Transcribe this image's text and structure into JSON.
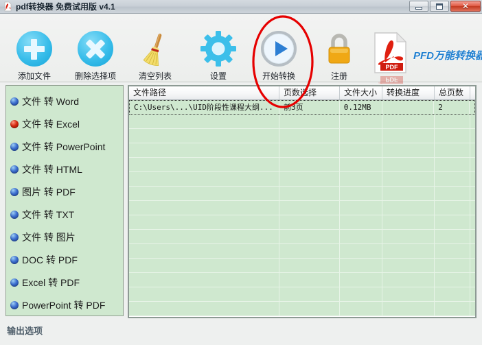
{
  "window": {
    "title": "pdf转换器 免费试用版 v4.1",
    "icon": "pdf-app-icon",
    "controls": [
      {
        "name": "minimize-button",
        "glyph": "minimize-icon"
      },
      {
        "name": "maximize-button",
        "glyph": "maximize-icon"
      },
      {
        "name": "close-button",
        "glyph": "close-icon",
        "label": "✕"
      }
    ]
  },
  "toolbar": {
    "buttons": [
      {
        "id": "add-file",
        "label": "添加文件",
        "icon": "plus-circle-icon"
      },
      {
        "id": "delete-selected",
        "label": "删除选择项",
        "icon": "cross-circle-icon"
      },
      {
        "id": "clear-list",
        "label": "清空列表",
        "icon": "broom-icon"
      },
      {
        "id": "settings",
        "label": "设置",
        "icon": "gear-icon"
      },
      {
        "id": "start-convert",
        "label": "开始转换",
        "icon": "play-circle-icon"
      },
      {
        "id": "register",
        "label": "注册",
        "icon": "lock-icon"
      }
    ],
    "logo": {
      "text": "PFD万能转换器",
      "icon": "pdf-document-icon",
      "icon_label": "PDF",
      "text_color": "#1f7fd0"
    },
    "annotation": {
      "name": "red-ellipse-highlight",
      "target": "start-convert",
      "color": "#e60000"
    }
  },
  "sidebar": {
    "selected_index": 1,
    "items": [
      {
        "label": "文件 转 Word"
      },
      {
        "label": "文件 转 Excel"
      },
      {
        "label": "文件 转 PowerPoint"
      },
      {
        "label": "文件 转 HTML"
      },
      {
        "label": "图片 转 PDF"
      },
      {
        "label": "文件 转 TXT"
      },
      {
        "label": "文件 转 图片"
      },
      {
        "label": "DOC 转 PDF"
      },
      {
        "label": "Excel 转 PDF"
      },
      {
        "label": "PowerPoint 转 PDF"
      }
    ],
    "radio_unselected_color": "#3d6fd0",
    "radio_selected_color": "#d62a10"
  },
  "output_options_label": "输出选项",
  "file_table": {
    "columns": [
      "文件路径",
      "页数选择",
      "文件大小",
      "转换进度",
      "总页数",
      ""
    ],
    "rows": [
      {
        "path": "C:\\Users\\...\\UID阶段性课程大纲...",
        "pages": "前3页",
        "size": "0.12MB",
        "progress": "",
        "total_pages": "2",
        "selected": true
      },
      {
        "path": "",
        "pages": "",
        "size": "",
        "progress": "",
        "total_pages": "",
        "selected": false
      },
      {
        "path": "",
        "pages": "",
        "size": "",
        "progress": "",
        "total_pages": "",
        "selected": false
      },
      {
        "path": "",
        "pages": "",
        "size": "",
        "progress": "",
        "total_pages": "",
        "selected": false
      },
      {
        "path": "",
        "pages": "",
        "size": "",
        "progress": "",
        "total_pages": "",
        "selected": false
      },
      {
        "path": "",
        "pages": "",
        "size": "",
        "progress": "",
        "total_pages": "",
        "selected": false
      },
      {
        "path": "",
        "pages": "",
        "size": "",
        "progress": "",
        "total_pages": "",
        "selected": false
      },
      {
        "path": "",
        "pages": "",
        "size": "",
        "progress": "",
        "total_pages": "",
        "selected": false
      },
      {
        "path": "",
        "pages": "",
        "size": "",
        "progress": "",
        "total_pages": "",
        "selected": false
      },
      {
        "path": "",
        "pages": "",
        "size": "",
        "progress": "",
        "total_pages": "",
        "selected": false
      },
      {
        "path": "",
        "pages": "",
        "size": "",
        "progress": "",
        "total_pages": "",
        "selected": false
      },
      {
        "path": "",
        "pages": "",
        "size": "",
        "progress": "",
        "total_pages": "",
        "selected": false
      },
      {
        "path": "",
        "pages": "",
        "size": "",
        "progress": "",
        "total_pages": "",
        "selected": false
      },
      {
        "path": "",
        "pages": "",
        "size": "",
        "progress": "",
        "total_pages": "",
        "selected": false
      },
      {
        "path": "",
        "pages": "",
        "size": "",
        "progress": "",
        "total_pages": "",
        "selected": false
      }
    ],
    "row_background": "#cfe8cf"
  }
}
